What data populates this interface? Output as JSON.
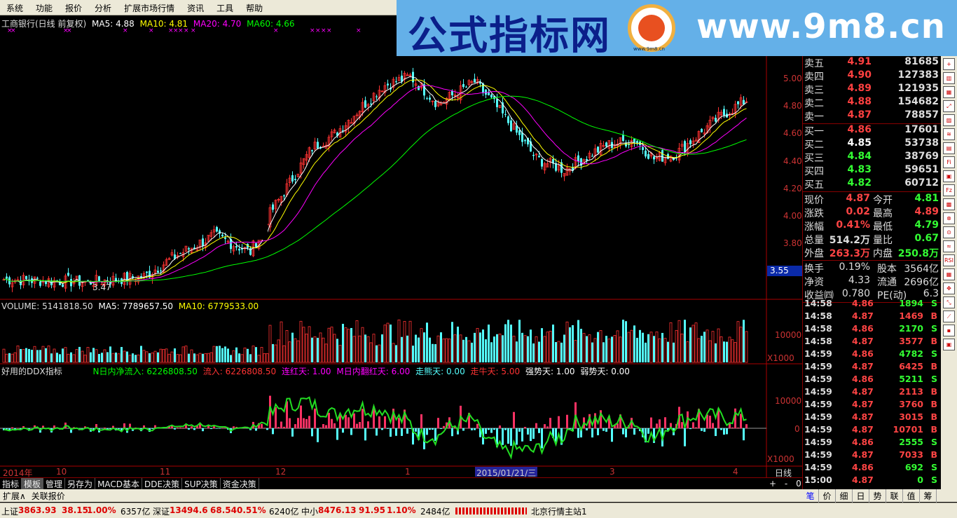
{
  "menu": [
    "系统",
    "功能",
    "报价",
    "分析",
    "扩展市场行情",
    "资讯",
    "工具",
    "帮助"
  ],
  "watermark": {
    "cn": "公式指标网",
    "url": "www.9m8.cn",
    "small": "www.9m8.cn"
  },
  "chart": {
    "title": "工商银行(日线 前复权)",
    "ma5": "MA5: 4.88",
    "ma10": "MA10: 4.81",
    "ma20": "MA20: 4.70",
    "ma60": "MA60: 4.66",
    "price_ticks": [
      "5.00",
      "4.80",
      "4.60",
      "4.40",
      "4.20",
      "4.00",
      "3.80"
    ],
    "cursor_price": "3.55",
    "low_label": "3.47",
    "volume": {
      "title": "VOLUME: 5141818.50",
      "ma5": "MA5: 7789657.50",
      "ma10": "MA10: 6779533.00",
      "tick": "10000",
      "unit": "X1000"
    },
    "ddx": {
      "title": "好用的DDX指标",
      "inflow_net": "N日内净流入: 6226808.50",
      "inflow": "流入: 6226808.50",
      "lianhong": "连红天: 1.00",
      "fanhong": "M日内翻红天: 6.00",
      "zouxiong": "走熊天: 0.00",
      "zouniu": "走牛天: 5.00",
      "qiangshi": "强势天: 1.00",
      "ruoshi": "弱势天: 0.00",
      "tick_top": "10000",
      "tick_zero": "0",
      "unit": "X1000"
    },
    "date_axis": {
      "labels": [
        "2014年",
        "10",
        "11",
        "12",
        "1",
        "3",
        "4"
      ],
      "cursor": "2015/01/21/三",
      "period": "日线"
    },
    "colors": {
      "up": "#ff3232",
      "down": "#54ffff",
      "ma5": "#ffffff",
      "ma10": "#ffff00",
      "ma20": "#ff00ff",
      "ma60": "#00ff00"
    }
  },
  "quote": {
    "sell": [
      {
        "l": "卖五",
        "p": "4.91",
        "v": "81685"
      },
      {
        "l": "卖四",
        "p": "4.90",
        "v": "127383"
      },
      {
        "l": "卖三",
        "p": "4.89",
        "v": "121935"
      },
      {
        "l": "卖二",
        "p": "4.88",
        "v": "154682"
      },
      {
        "l": "卖一",
        "p": "4.87",
        "v": "78857"
      }
    ],
    "buy": [
      {
        "l": "买一",
        "p": "4.86",
        "v": "17601"
      },
      {
        "l": "买二",
        "p": "4.85",
        "v": "53738"
      },
      {
        "l": "买三",
        "p": "4.84",
        "v": "38769"
      },
      {
        "l": "买四",
        "p": "4.83",
        "v": "59651"
      },
      {
        "l": "买五",
        "p": "4.82",
        "v": "60712"
      }
    ],
    "stats": [
      {
        "a": "现价",
        "b": "4.87",
        "c": "今开",
        "d": "4.81"
      },
      {
        "a": "涨跌",
        "b": "0.02",
        "c": "最高",
        "d": "4.89"
      },
      {
        "a": "涨幅",
        "b": "0.41%",
        "c": "最低",
        "d": "4.79"
      },
      {
        "a": "总量",
        "b": "514.2万",
        "c": "量比",
        "d": "0.67"
      },
      {
        "a": "外盘",
        "b": "263.3万",
        "c": "内盘",
        "d": "250.8万"
      }
    ],
    "stats2": [
      {
        "a": "换手",
        "b": "0.19%",
        "c": "股本",
        "d": "3564亿"
      },
      {
        "a": "净资",
        "b": "4.33",
        "c": "流通",
        "d": "2696亿"
      },
      {
        "a": "收益㈣",
        "b": "0.780",
        "c": "PE(动)",
        "d": "6.3"
      }
    ]
  },
  "ticks": [
    {
      "t": "14:58",
      "p": "4.86",
      "v": "1894",
      "s": "S"
    },
    {
      "t": "14:58",
      "p": "4.87",
      "v": "1469",
      "s": "B"
    },
    {
      "t": "14:58",
      "p": "4.86",
      "v": "2170",
      "s": "S"
    },
    {
      "t": "14:58",
      "p": "4.87",
      "v": "3577",
      "s": "B"
    },
    {
      "t": "14:59",
      "p": "4.86",
      "v": "4782",
      "s": "S"
    },
    {
      "t": "14:59",
      "p": "4.87",
      "v": "6425",
      "s": "B"
    },
    {
      "t": "14:59",
      "p": "4.86",
      "v": "5211",
      "s": "S"
    },
    {
      "t": "14:59",
      "p": "4.87",
      "v": "2113",
      "s": "B"
    },
    {
      "t": "14:59",
      "p": "4.87",
      "v": "3760",
      "s": "B"
    },
    {
      "t": "14:59",
      "p": "4.87",
      "v": "3015",
      "s": "B"
    },
    {
      "t": "14:59",
      "p": "4.87",
      "v": "10701",
      "s": "B"
    },
    {
      "t": "14:59",
      "p": "4.86",
      "v": "2555",
      "s": "S"
    },
    {
      "t": "14:59",
      "p": "4.87",
      "v": "7033",
      "s": "B"
    },
    {
      "t": "14:59",
      "p": "4.86",
      "v": "692",
      "s": "S"
    },
    {
      "t": "15:00",
      "p": "4.87",
      "v": "0",
      "s": "S"
    }
  ],
  "toolbar": [
    "指标",
    "模板",
    "管理",
    "另存为",
    "MACD基本",
    "DDE决策",
    "SUP决策",
    "资金决策"
  ],
  "toolbar2": [
    "扩展∧",
    "关联报价"
  ],
  "zoom": [
    "+",
    "-",
    "0"
  ],
  "right_tabs": [
    "笔",
    "价",
    "细",
    "日",
    "势",
    "联",
    "值",
    "筹"
  ],
  "status": {
    "sh": "上证",
    "sh_v": "3863.93",
    "sh_c": "38.15",
    "sh_p": "1.00%",
    "sh_a": "6357亿",
    "sz": "深证",
    "sz_v": "13494.6",
    "sz_c": "68.54",
    "sz_p": "0.51%",
    "sz_a": "6240亿",
    "zx": "中小",
    "zx_v": "8476.13",
    "zx_c": "91.95",
    "zx_p": "1.10%",
    "zx_a": "2484亿",
    "station": "北京行情主站1"
  },
  "side_icons": [
    "+",
    "▥",
    "▦",
    "⤢",
    "▨",
    "≋",
    "▤",
    "Fi",
    "▣",
    "Fz",
    "▩",
    "⊗",
    "⊙",
    "≈",
    "RSI",
    "▦",
    "✥",
    "⤡",
    "⟋",
    "▪",
    "▣"
  ]
}
